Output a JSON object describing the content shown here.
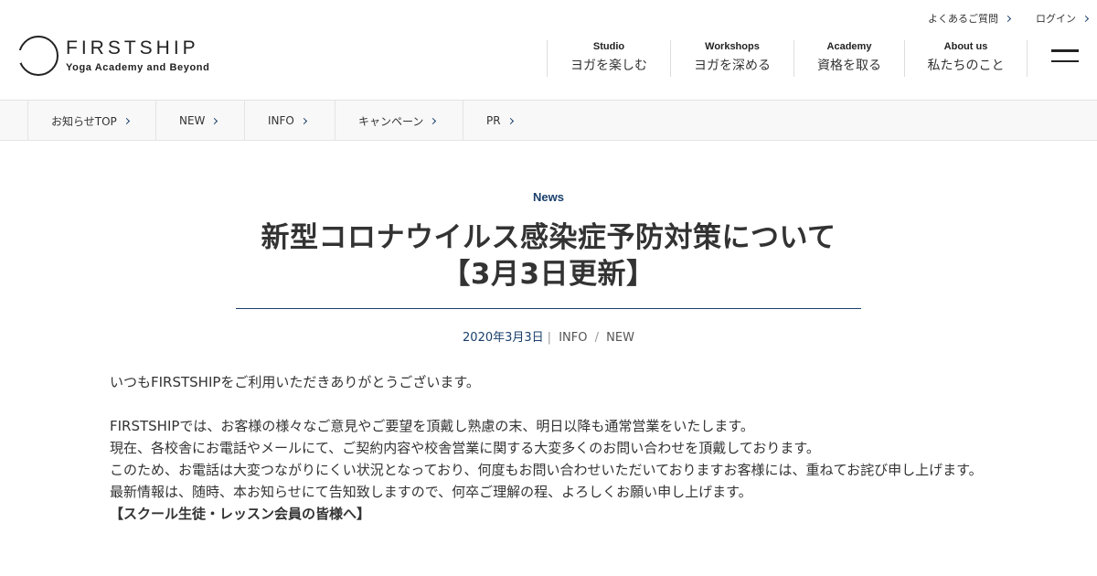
{
  "logo": {
    "name": "FIRSTSHIP",
    "tagline": "Yoga Academy and Beyond"
  },
  "util_links": [
    {
      "label": "よくあるご質問"
    },
    {
      "label": "ログイン"
    }
  ],
  "global_nav": [
    {
      "en": "Studio",
      "ja": "ヨガを楽しむ"
    },
    {
      "en": "Workshops",
      "ja": "ヨガを深める"
    },
    {
      "en": "Academy",
      "ja": "資格を取る"
    },
    {
      "en": "About us",
      "ja": "私たちのこと"
    }
  ],
  "sub_nav": [
    {
      "label": "お知らせTOP"
    },
    {
      "label": "NEW"
    },
    {
      "label": "INFO"
    },
    {
      "label": "キャンペーン"
    },
    {
      "label": "PR"
    }
  ],
  "article": {
    "category": "News",
    "title_line1": "新型コロナウイルス感染症予防対策について",
    "title_line2": "【3月3日更新】",
    "date": "2020年3月3日",
    "tags": [
      "INFO",
      "NEW"
    ],
    "paragraphs": {
      "p1": "いつもFIRSTSHIPをご利用いただきありがとうございます。",
      "p2": "FIRSTSHIPでは、お客様の様々なご意見やご要望を頂戴し熟慮の末、明日以降も通常営業をいたします。",
      "p3": "現在、各校舎にお電話やメールにて、ご契約内容や校舎営業に関する大変多くのお問い合わせを頂戴しております。",
      "p4": "このため、お電話は大変つながりにくい状況となっており、何度もお問い合わせいただいておりますお客様には、重ねてお詫び申し上げます。",
      "p5": "最新情報は、随時、本お知らせにて告知致しますので、何卒ご理解の程、よろしくお願い申し上げます。",
      "p6": "【スクール生徒・レッスン会員の皆様へ】"
    }
  }
}
